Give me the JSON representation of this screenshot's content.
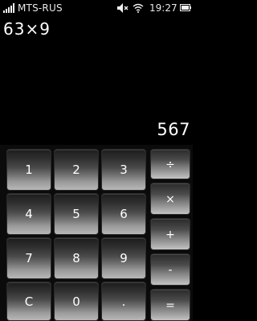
{
  "status_bar": {
    "carrier": "MTS-RUS",
    "time": "19:27",
    "icons": [
      "signal-icon",
      "mute-icon",
      "wifi-icon",
      "battery-icon"
    ]
  },
  "display": {
    "expression": "63×9",
    "result": "567"
  },
  "keypad": {
    "k1": "1",
    "k2": "2",
    "k3": "3",
    "k4": "4",
    "k5": "5",
    "k6": "6",
    "k7": "7",
    "k8": "8",
    "k9": "9",
    "clear": "C",
    "k0": "0",
    "dot": ".",
    "divide": "÷",
    "multiply": "×",
    "plus": "+",
    "minus": "-",
    "equals": "="
  }
}
